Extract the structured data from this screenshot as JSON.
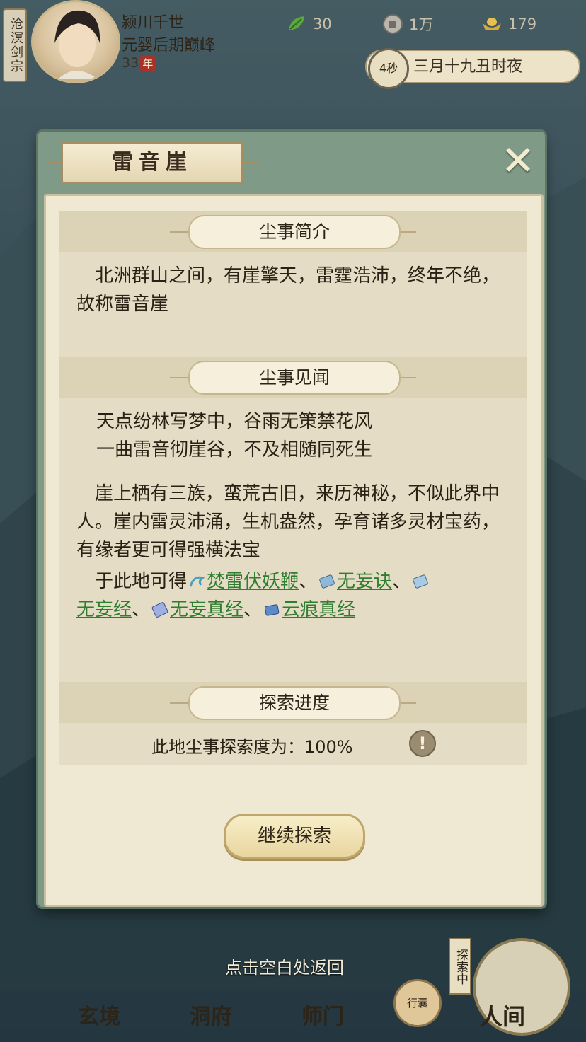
{
  "hud": {
    "sect": "沧溟剑宗",
    "player_name": "颍川千世",
    "realm": "元婴后期巅峰",
    "age": "33",
    "age_unit": "年",
    "resources": [
      {
        "icon": "jade-leaf-icon",
        "value": "30"
      },
      {
        "icon": "coin-icon",
        "value": "1万"
      },
      {
        "icon": "gold-ingot-icon",
        "value": "179"
      }
    ],
    "timer": "4秒",
    "date": "三月十九丑时夜"
  },
  "dialog": {
    "title": "雷音崖",
    "close_label": "✕",
    "intro_header": "尘事简介",
    "intro_text": "　北洲群山之间，有崖擎天，雷霆浩沛，终年不绝，故称雷音崖",
    "lore_header": "尘事见闻",
    "poem_line1": "天点纷林写梦中，谷雨无策禁花风",
    "poem_line2": "一曲雷音彻崖谷，不及相随同死生",
    "lore_text": "　崖上栖有三族，蛮荒古旧，来历神秘，不似此界中人。崖内雷灵沛涌，生机盎然，孕育诸多灵材宝药，有缘者更可得强横法宝",
    "loot_prefix": "于此地可得",
    "loot": [
      "焚雷伏妖鞭",
      "无妄诀",
      "无妄经",
      "无妄真经",
      "云痕真经"
    ],
    "separator": "、",
    "progress_header": "探索进度",
    "progress_text": "此地尘事探索度为：100%",
    "progress_value": 100,
    "info_label": "!",
    "continue_button": "继续探索"
  },
  "hint": "点击空白处返回",
  "nav": {
    "items": [
      "玄境",
      "洞府",
      "师门",
      "人间"
    ],
    "bag_label": "行囊",
    "explore_tag": "探索中"
  },
  "colors": {
    "link": "#2f7d2f",
    "dialog_frame": "#7f9a86",
    "parchment": "#efe9d4"
  }
}
